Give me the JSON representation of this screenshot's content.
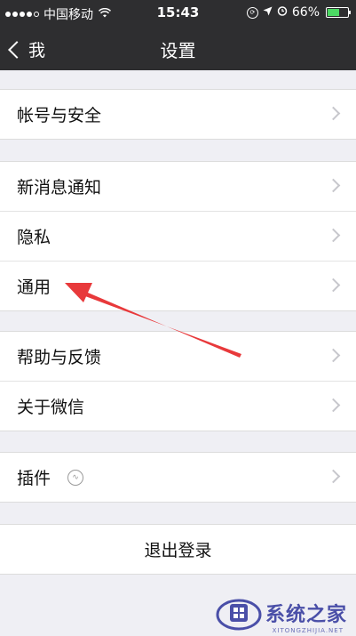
{
  "status_bar": {
    "carrier": "中国移动",
    "time": "15:43",
    "battery": "66%",
    "battery_fraction": 0.66,
    "signal_dots_filled": 4,
    "signal_dots_total": 5
  },
  "nav": {
    "back_label": "我",
    "title": "设置"
  },
  "groups": [
    {
      "rows": [
        {
          "label": "帐号与安全"
        }
      ]
    },
    {
      "rows": [
        {
          "label": "新消息通知"
        },
        {
          "label": "隐私"
        },
        {
          "label": "通用"
        }
      ]
    },
    {
      "rows": [
        {
          "label": "帮助与反馈"
        },
        {
          "label": "关于微信"
        }
      ]
    },
    {
      "rows": [
        {
          "label": "插件",
          "icon": "lightbulb-icon"
        }
      ]
    }
  ],
  "logout_label": "退出登录",
  "annotation": {
    "color": "#e8393b",
    "target": "通用"
  },
  "watermark": {
    "text": "系统之家",
    "subtext": "XITONGZHIJIA.NET",
    "color": "#4a4fa8"
  },
  "colors": {
    "nav_bg": "#2e2e30",
    "page_bg": "#efeff4",
    "battery": "#4cd964"
  }
}
